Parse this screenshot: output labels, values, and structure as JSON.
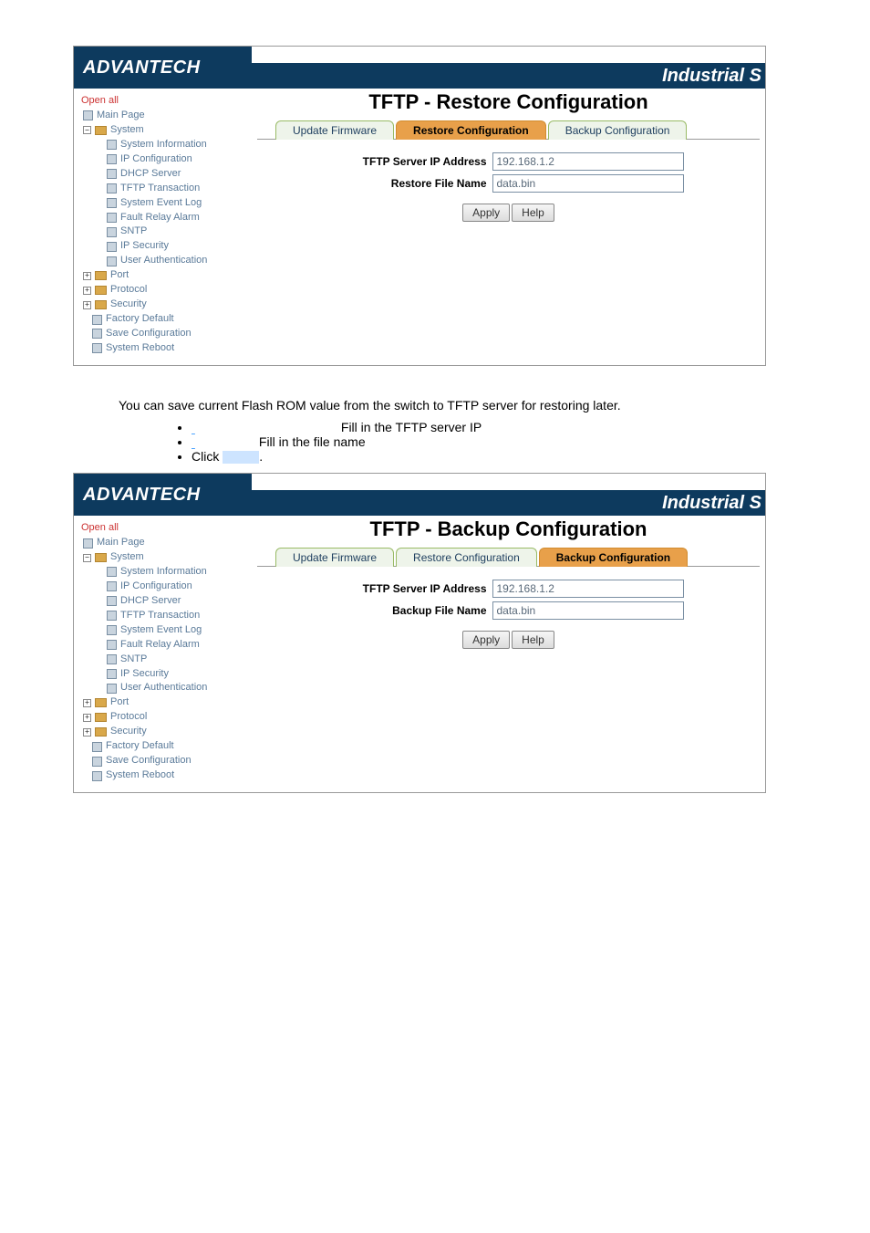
{
  "brand": "ADVANTECH",
  "product_line": "Industrial S",
  "sidebar": {
    "open_all": "Open all",
    "main_page": "Main Page",
    "system": "System",
    "system_children": [
      "System Information",
      "IP Configuration",
      "DHCP Server",
      "TFTP Transaction",
      "System Event Log",
      "Fault Relay Alarm",
      "SNTP",
      "IP Security",
      "User Authentication"
    ],
    "port": "Port",
    "protocol": "Protocol",
    "security": "Security",
    "factory_default": "Factory Default",
    "save_config": "Save Configuration",
    "system_reboot": "System Reboot"
  },
  "screen1": {
    "title": "TFTP - Restore Configuration",
    "tabs": [
      "Update Firmware",
      "Restore Configuration",
      "Backup Configuration"
    ],
    "active_tab": 1,
    "ip_label": "TFTP Server IP Address",
    "ip_value": "192.168.1.2",
    "file_label": "Restore File Name",
    "file_value": "data.bin",
    "apply": "Apply",
    "help": "Help"
  },
  "doc": {
    "intro": "You can save current Flash ROM value from the switch to TFTP server for restoring later.",
    "bullet1_prefix": "",
    "bullet1_text": "Fill in the TFTP server IP",
    "bullet2_text": "Fill in the file name",
    "bullet3_prefix": "Click"
  },
  "screen2": {
    "title": "TFTP - Backup Configuration",
    "tabs": [
      "Update Firmware",
      "Restore Configuration",
      "Backup Configuration"
    ],
    "active_tab": 2,
    "ip_label": "TFTP Server IP Address",
    "ip_value": "192.168.1.2",
    "file_label": "Backup File Name",
    "file_value": "data.bin",
    "apply": "Apply",
    "help": "Help"
  }
}
